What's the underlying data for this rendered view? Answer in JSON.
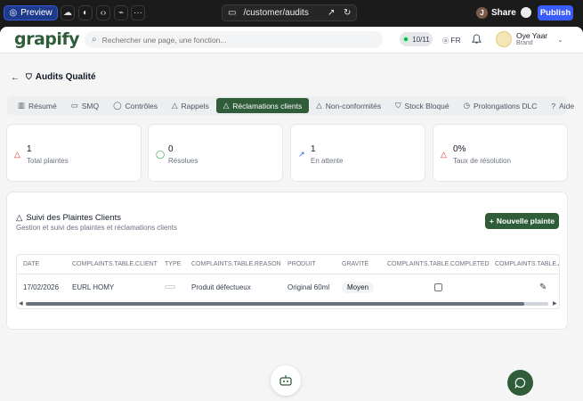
{
  "browser": {
    "preview_label": "Preview",
    "url": "/customer/audits",
    "share_label": "Share",
    "share_avatar_initial": "J",
    "publish_label": "Publish"
  },
  "header": {
    "logo": "grapify",
    "search_placeholder": "Rechercher une page, une fonction...",
    "score": "10/11",
    "language": "FR",
    "user_name": "Oye Yaar",
    "user_role": "Brand"
  },
  "page": {
    "title": "Audits Qualité"
  },
  "tabs": [
    {
      "label": "Résumé",
      "icon": "chart-icon"
    },
    {
      "label": "SMQ",
      "icon": "folder-icon"
    },
    {
      "label": "Contrôles",
      "icon": "check-circle-icon"
    },
    {
      "label": "Rappels",
      "icon": "warning-icon"
    },
    {
      "label": "Réclamations clients",
      "icon": "warning-icon",
      "active": true
    },
    {
      "label": "Non-conformités",
      "icon": "warning-icon"
    },
    {
      "label": "Stock Bloqué",
      "icon": "shield-icon"
    },
    {
      "label": "Prolongations DLC",
      "icon": "clock-icon"
    },
    {
      "label": "Aide",
      "icon": "help-icon"
    }
  ],
  "stats": [
    {
      "value": "1",
      "label": "Total plaintes",
      "icon": "warning-icon",
      "color": "#dc2626"
    },
    {
      "value": "0",
      "label": "Résolues",
      "icon": "check-circle-icon",
      "color": "#16a34a"
    },
    {
      "value": "1",
      "label": "En attente",
      "icon": "trend-icon",
      "color": "#2563eb"
    },
    {
      "value": "0%",
      "label": "Taux de résolution",
      "icon": "warning-icon",
      "color": "#dc2626"
    }
  ],
  "panel": {
    "title": "Suivi des Plaintes Clients",
    "subtitle": "Gestion et suivi des plaintes et réclamations clients",
    "new_button": "Nouvelle plainte"
  },
  "table": {
    "headers": [
      "DATE",
      "COMPLAINTS.TABLE.CLIENT",
      "TYPE",
      "COMPLAINTS.TABLE.REASON",
      "PRODUIT",
      "GRAVITÉ",
      "COMPLAINTS.TABLE.COMPLETED",
      "COMPLAINTS.TABLE.A"
    ],
    "rows": [
      {
        "date": "17/02/2026",
        "client": "EURL HOMY",
        "reason": "Produit défectueux",
        "product": "Original 60ml",
        "severity": "Moyen",
        "completed": false
      }
    ]
  },
  "colors": {
    "brand": "#2f5d3a",
    "publish": "#3b5bfa"
  }
}
